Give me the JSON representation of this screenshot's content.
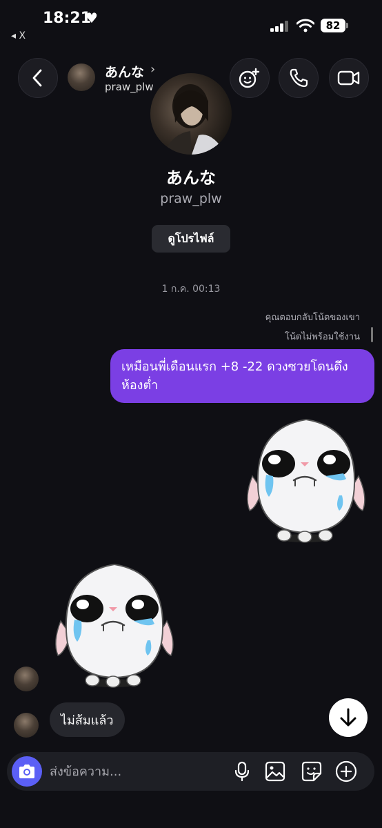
{
  "status_bar": {
    "time": "18:21",
    "back_app": "◂ X",
    "battery": "82"
  },
  "header": {
    "name": "あんな",
    "username": "praw_plw"
  },
  "profile": {
    "name": "あんな",
    "username": "praw_plw",
    "view_profile_label": "ดูโปรไฟล์"
  },
  "thread": {
    "timestamp": "1 ก.ค. 00:13",
    "note_reply_label": "คุณตอบกลับโน้ตของเขา",
    "note_unavailable_label": "โน้ตไม่พร้อมใช้งาน",
    "sent_message": "เหมือนพี่เดือนแรก +8 -22 ดวงซวยโดนดึงห้องต่ำ",
    "received_message": "ไม่ส้มแล้ว"
  },
  "composer": {
    "placeholder": "ส่งข้อความ..."
  },
  "colors": {
    "background": "#0f0f14",
    "sent_bubble": "#7b3fe4",
    "received_bubble": "#26272d",
    "camera_button": "#5b5ff5"
  }
}
